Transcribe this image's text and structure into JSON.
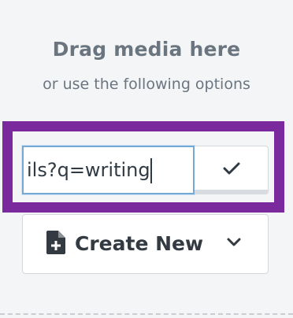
{
  "upload_panel": {
    "title": "Drag media here",
    "subtitle": "or use the following options"
  },
  "url_input": {
    "value": "https://www.example.com/details?q=writing",
    "visible_value": "ils?q=writing"
  },
  "confirm_button": {
    "icon": "checkmark-icon"
  },
  "create_button": {
    "label": "Create New",
    "icon": "new-document-icon",
    "dropdown_icon": "chevron-down-icon"
  },
  "colors": {
    "highlight_border": "#7a2a9c",
    "input_focus_border": "#74a9d6",
    "text_muted": "#6b7580",
    "text_dark": "#333a41"
  }
}
